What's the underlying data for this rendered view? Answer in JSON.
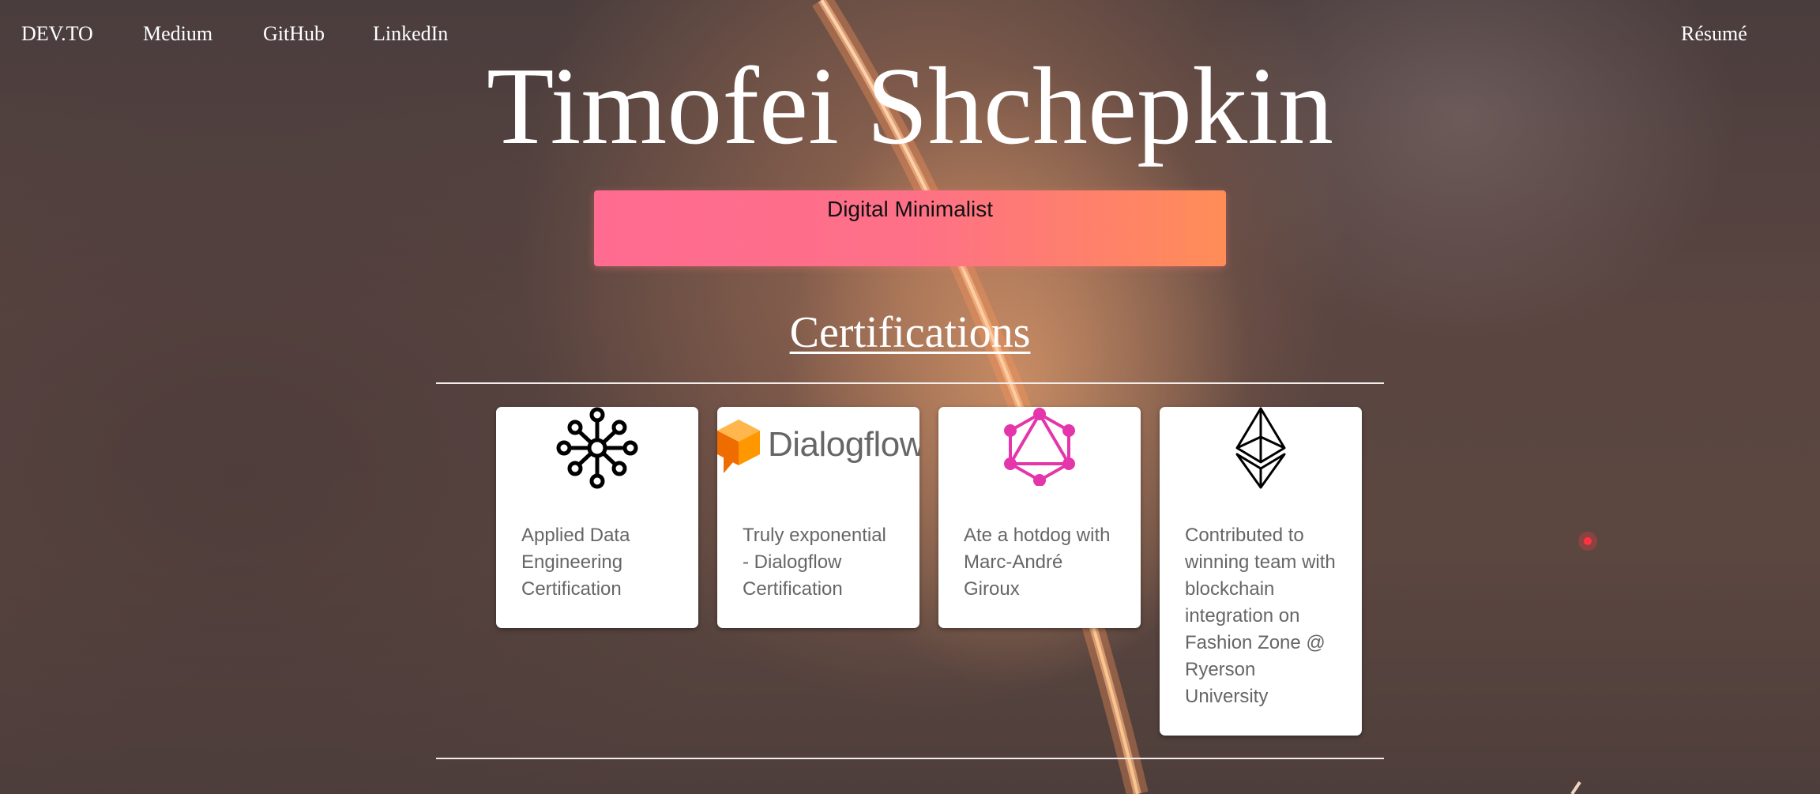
{
  "nav": {
    "devto": "DEV.TO",
    "medium": "Medium",
    "github": "GitHub",
    "linkedin": "LinkedIn",
    "resume": "Résumé"
  },
  "hero": {
    "name": "Timofei Shchepkin",
    "tagline": "Digital Minimalist"
  },
  "certifications": {
    "heading": "Certifications",
    "cards": [
      {
        "icon": "neural-network-icon",
        "text": "Applied Data Engineering Certification"
      },
      {
        "icon": "dialogflow-logo",
        "logo_text": "Dialogflow",
        "text": "Truly exponential - Dialogflow Certification"
      },
      {
        "icon": "graphql-icon",
        "text": "Ate a hotdog with Marc-André Giroux"
      },
      {
        "icon": "ethereum-icon",
        "text": "Contributed to winning team with blockchain integration on Fashion Zone @ Ryerson University"
      }
    ]
  },
  "colors": {
    "tagline_gradient_start": "#ff6b91",
    "tagline_gradient_end": "#ff8d57",
    "graphql_pink": "#e535ab",
    "dialogflow_orange": "#ff9800",
    "card_text": "#666666"
  }
}
